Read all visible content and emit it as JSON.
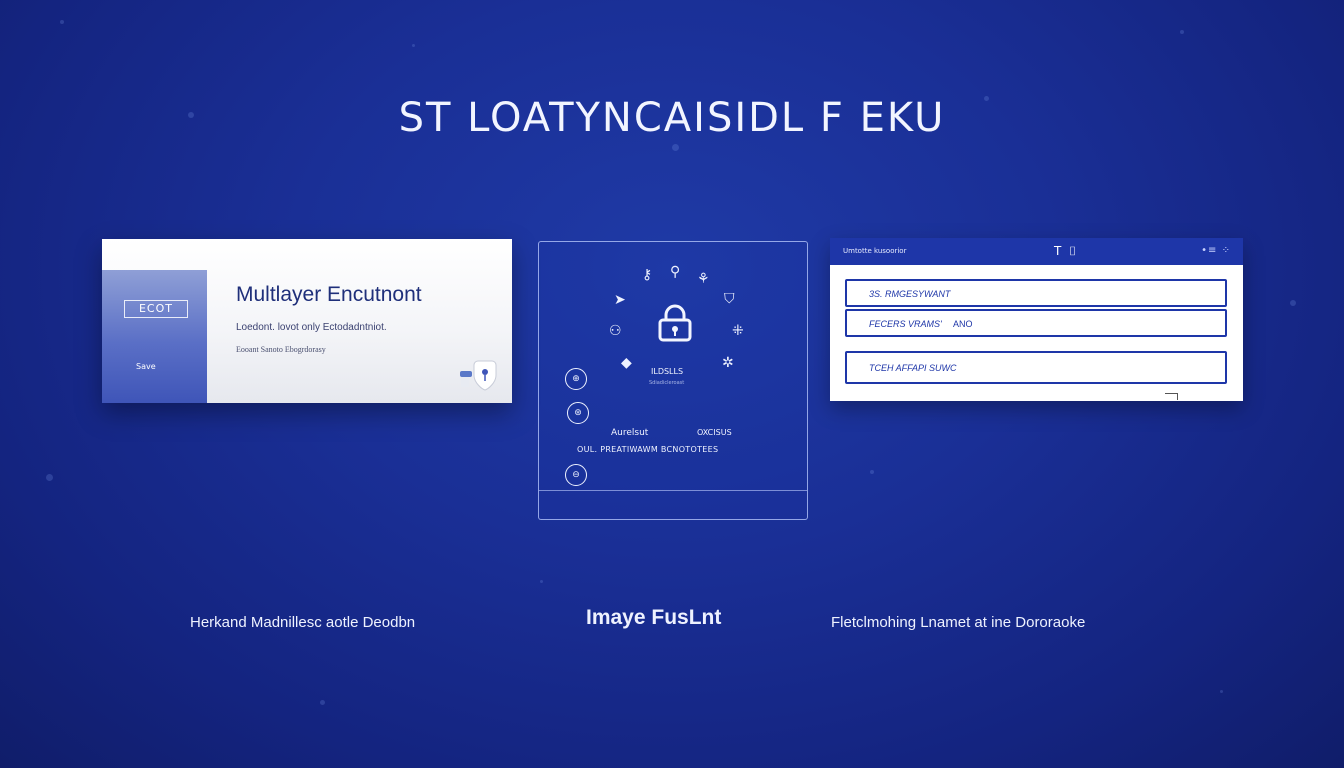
{
  "page": {
    "title": "ST LOATYNCAISIDL F EKU"
  },
  "card_left": {
    "logo": "ECOT",
    "side_label": "Save",
    "title": "Multlayer Encutnont",
    "line1": "Loedont. lovot only Ectodadntniot.",
    "line2": "Eooant Sanoto Ebogrdorasy",
    "icon": "shield-pin-icon"
  },
  "card_center": {
    "lock_label": "ILDSLLS",
    "lock_sub": "Sdiadicleroast",
    "row1_left": "Aurelsut",
    "row1_right": "OXCISUS",
    "row2": "OUL. PREATIWAWM BCNOTOTEES",
    "icons": [
      "key-icon",
      "key-icon",
      "user-icon",
      "pin-icon",
      "shield-icon",
      "users-icon",
      "users-icon",
      "pin-icon",
      "asterisk-icon",
      "lock-icon",
      "globe-icon",
      "globe-icon",
      "globe-icon"
    ]
  },
  "card_right": {
    "header_title": "Umtotte kusoorior",
    "header_icons": "T ⌷",
    "header_dots": "•≡ ⁘",
    "fields": [
      {
        "value": "3S. RMGESYWANT",
        "suffix": ""
      },
      {
        "value": "FECERS VRAMS'",
        "suffix": "ANO"
      },
      {
        "value": "TCEH AFFAPI SUWC",
        "suffix": ""
      }
    ]
  },
  "captions": {
    "left": "Herkand Madnillesc aotle Deodbn",
    "center": "Imaye FusLnt",
    "right": "Fletclmohing Lnamet at ine Dororaoke"
  },
  "colors": {
    "background": "#1a2f96",
    "accent": "#1e36a8",
    "card_title": "#1f2f7a"
  }
}
